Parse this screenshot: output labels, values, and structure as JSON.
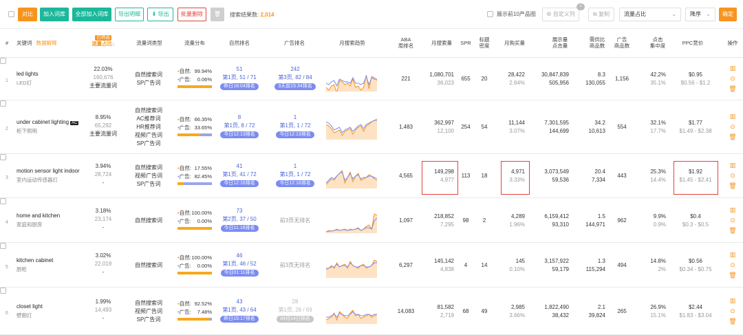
{
  "toolbar": {
    "compare": "对比",
    "add_lib": "加入词库",
    "add_all_lib": "全部加入词库",
    "export_detail": "导出明细",
    "export": "导出",
    "batch_delete": "批量删除",
    "result_label": "搜索结果数:",
    "result_count": "2,014",
    "show_top10": "展示前10产品图",
    "custom_cols": "自定义列",
    "custom_badge": "+",
    "copy": "复制",
    "sort_field": "流量占比",
    "sort_order": "降序",
    "confirm": "确定"
  },
  "header": {
    "num": "#",
    "keyword": "关键词",
    "keyword_link": "数据解释",
    "flow_share_tag": "已筛选",
    "flow_share": "流量占比",
    "flow_type": "流量词类型",
    "flow_dist": "流量分布",
    "natural_rank": "自然排名",
    "ad_rank": "广告排名",
    "trend": "月搜索趋势",
    "aba1": "ABA",
    "aba2": "周排名",
    "monthly_search": "月搜索量",
    "spr": "SPR",
    "title_density1": "标题",
    "title_density2": "密度",
    "monthly_buy": "月购买量",
    "impressions1": "展示量",
    "impressions2": "点击量",
    "supply1": "需供比",
    "supply2": "商品数",
    "ad_products1": "广告",
    "ad_products2": "商品数",
    "click_conc1": "点击",
    "click_conc2": "集中度",
    "ppc": "PPC竞价",
    "ops": "操作"
  },
  "rows": [
    {
      "num": "1",
      "keyword": "led lights",
      "ac": "",
      "cn": "LED灯",
      "share": "22.03%",
      "share_sub": "160,676",
      "share_type": "主要流量词",
      "types": [
        "自然搜索词",
        "SP广告词"
      ],
      "nat_label": "自然:",
      "nat_pct": "99.94%",
      "ad_label": "广告:",
      "ad_pct": "0.06%",
      "nat_frac": 0.9994,
      "nr_main": "51",
      "nr_page": "第1页, 51 / 71",
      "nr_badge": "昨日18:04排名",
      "ar_main": "242",
      "ar_page": "第3页, 82 / 84",
      "ar_badge": "3天前15:34排名",
      "aba": "221",
      "ms": "1,080,701",
      "ms_sub": "36,023",
      "spr": "655",
      "td": "20",
      "mb": "28,422",
      "mb_sub": "2.64%",
      "imp": "30,847,839",
      "clk": "505,956",
      "sd": "8.3",
      "sd_sub": "130,055",
      "adp": "1,156",
      "cc": "42.2%",
      "cc_sub": "35.1%",
      "ppc": "$0.95",
      "ppc_sub": "$0.56 - $1.2",
      "trend_a": [
        30,
        34,
        28,
        26,
        38,
        20,
        22,
        26,
        24,
        28,
        18,
        30,
        28,
        34,
        30,
        12,
        32,
        14,
        16,
        20
      ],
      "trend_b": [
        24,
        26,
        22,
        20,
        28,
        18,
        20,
        22,
        22,
        24,
        16,
        24,
        24,
        26,
        24,
        14,
        26,
        16,
        18,
        18
      ]
    },
    {
      "num": "2",
      "keyword": "under cabinet lighting",
      "ac": "AC",
      "cn": "柜下照明",
      "share": "8.95%",
      "share_sub": "65,292",
      "share_type": "主要流量词",
      "types": [
        "自然搜索词",
        "AC推荐词",
        "HR推荐词",
        "视频广告词",
        "SP广告词"
      ],
      "nat_label": "自然:",
      "nat_pct": "66.35%",
      "ad_label": "广告:",
      "ad_pct": "33.65%",
      "nat_frac": 0.6635,
      "nr_main": "8",
      "nr_page": "第1页, 8 / 72",
      "nr_badge": "今日12:13排名",
      "ar_main": "1",
      "ar_page": "第1页, 1 / 72",
      "ar_badge": "今日12:13排名",
      "aba": "1,483",
      "ms": "362,997",
      "ms_sub": "12,100",
      "spr": "254",
      "td": "54",
      "mb": "11,144",
      "mb_sub": "3.07%",
      "imp": "7,301,595",
      "clk": "144,699",
      "sd": "34.2",
      "sd_sub": "10,613",
      "adp": "554",
      "cc": "32.1%",
      "cc_sub": "17.7%",
      "ppc": "$1.77",
      "ppc_sub": "$1.49 - $2.38",
      "trend_a": [
        14,
        16,
        20,
        26,
        24,
        22,
        30,
        24,
        22,
        20,
        28,
        22,
        18,
        16,
        24,
        16,
        14,
        10,
        8,
        6
      ],
      "trend_b": [
        10,
        12,
        16,
        22,
        20,
        18,
        26,
        22,
        20,
        18,
        24,
        20,
        16,
        14,
        20,
        14,
        12,
        10,
        8,
        8
      ]
    },
    {
      "num": "3",
      "keyword": "motion sensor light indoor",
      "ac": "",
      "cn": "室内运动传感器灯",
      "share": "3.94%",
      "share_sub": "28,724",
      "share_type": "-",
      "types": [
        "自然搜索词",
        "视频广告词",
        "SP广告词"
      ],
      "nat_label": "自然:",
      "nat_pct": "17.55%",
      "ad_label": "广告:",
      "ad_pct": "82.45%",
      "nat_frac": 0.1755,
      "nr_main": "41",
      "nr_page": "第1页, 41 / 72",
      "nr_badge": "今日12:16排名",
      "ar_main": "1",
      "ar_page": "第1页, 1 / 72",
      "ar_badge": "今日12:16排名",
      "aba": "4,565",
      "ms": "149,298",
      "ms_sub": "4,977",
      "spr": "113",
      "td": "18",
      "mb": "4,971",
      "mb_sub": "3.33%",
      "imp": "3,073,549",
      "clk": "59,536",
      "sd": "20.4",
      "sd_sub": "7,334",
      "adp": "443",
      "cc": "25.3%",
      "cc_sub": "14.4%",
      "ppc": "$1.92",
      "ppc_sub": "$1.45 - $2.41",
      "trend_a": [
        30,
        26,
        22,
        24,
        18,
        14,
        10,
        28,
        20,
        12,
        26,
        18,
        14,
        24,
        22,
        20,
        16,
        18,
        22,
        24
      ],
      "trend_b": [
        28,
        24,
        20,
        22,
        18,
        14,
        12,
        24,
        20,
        14,
        22,
        18,
        16,
        22,
        20,
        20,
        18,
        18,
        20,
        22
      ]
    },
    {
      "num": "4",
      "keyword": "home and kitchen",
      "ac": "",
      "cn": "家庭和厨房",
      "share": "3.18%",
      "share_sub": "23,174",
      "share_type": "-",
      "types": [
        "自然搜索词"
      ],
      "nat_label": "自然:",
      "nat_pct": "100.00%",
      "ad_label": "广告:",
      "ad_pct": "0.00%",
      "nat_frac": 1.0,
      "nr_main": "73",
      "nr_page": "第2页, 37 / 50",
      "nr_badge": "今日11:16排名",
      "ar_main": "",
      "ar_page": "前3页无排名",
      "ar_badge": "",
      "aba": "1,097",
      "ms": "218,852",
      "ms_sub": "7,295",
      "spr": "98",
      "td": "2",
      "mb": "4,289",
      "mb_sub": "1.96%",
      "imp": "6,159,412",
      "clk": "93,310",
      "sd": "1.5",
      "sd_sub": "144,971",
      "adp": "962",
      "cc": "9.9%",
      "cc_sub": "0.9%",
      "ppc": "$0.4",
      "ppc_sub": "$0.3 - $0.5",
      "trend_a": [
        34,
        32,
        33,
        32,
        30,
        32,
        31,
        30,
        32,
        30,
        31,
        30,
        28,
        32,
        30,
        26,
        24,
        30,
        8,
        10
      ],
      "trend_b": [
        34,
        33,
        33,
        32,
        31,
        32,
        31,
        31,
        32,
        31,
        31,
        30,
        29,
        32,
        30,
        28,
        28,
        30,
        18,
        14
      ]
    },
    {
      "num": "5",
      "keyword": "kitchen cabinet",
      "ac": "",
      "cn": "厨柜",
      "share": "3.02%",
      "share_sub": "22,019",
      "share_type": "-",
      "types": [
        "自然搜索词"
      ],
      "nat_label": "自然:",
      "nat_pct": "100.00%",
      "ad_label": "广告:",
      "ad_pct": "0.00%",
      "nat_frac": 1.0,
      "nr_main": "46",
      "nr_page": "第1页, 46 / 52",
      "nr_badge": "今日01:11排名",
      "ar_main": "",
      "ar_page": "前3页无排名",
      "ar_badge": "",
      "aba": "6,297",
      "ms": "145,142",
      "ms_sub": "4,838",
      "spr": "4",
      "td": "14",
      "mb": "145",
      "mb_sub": "0.10%",
      "imp": "3,157,922",
      "clk": "59,179",
      "sd": "1.3",
      "sd_sub": "115,294",
      "adp": "494",
      "cc": "14.8%",
      "cc_sub": "2%",
      "ppc": "$0.56",
      "ppc_sub": "$0.34 - $0.75",
      "trend_a": [
        24,
        22,
        18,
        22,
        14,
        20,
        18,
        16,
        22,
        12,
        18,
        20,
        22,
        18,
        16,
        22,
        20,
        18,
        10,
        12
      ],
      "trend_b": [
        22,
        22,
        20,
        20,
        16,
        20,
        18,
        18,
        20,
        14,
        18,
        20,
        20,
        18,
        18,
        20,
        20,
        18,
        14,
        14
      ]
    },
    {
      "num": "6",
      "keyword": "closet light",
      "ac": "",
      "cn": "壁橱灯",
      "share": "1.99%",
      "share_sub": "14,493",
      "share_type": "-",
      "types": [
        "自然搜索词",
        "视频广告词",
        "SP广告词"
      ],
      "nat_label": "自然:",
      "nat_pct": "92.52%",
      "ad_label": "广告:",
      "ad_pct": "7.48%",
      "nat_frac": 0.9252,
      "nr_main": "43",
      "nr_page": "第1页, 43 / 64",
      "nr_badge": "昨日15:17排名",
      "ar_main": "28",
      "ar_page": "第1页, 28 / 69",
      "ar_badge": "04月14日排名",
      "aba": "14,083",
      "ms": "81,582",
      "ms_sub": "2,719",
      "spr": "68",
      "td": "49",
      "mb": "2,985",
      "mb_sub": "3.66%",
      "imp": "1,822,490",
      "clk": "38,432",
      "sd": "2.1",
      "sd_sub": "39,824",
      "adp": "265",
      "cc": "26.9%",
      "cc_sub": "15.1%",
      "ppc": "$2.44",
      "ppc_sub": "$1.83 - $3.04",
      "trend_a": [
        30,
        28,
        26,
        20,
        30,
        18,
        22,
        26,
        28,
        20,
        16,
        24,
        22,
        28,
        26,
        24,
        22,
        26,
        24,
        22
      ],
      "trend_b": [
        26,
        26,
        24,
        22,
        26,
        20,
        22,
        24,
        24,
        22,
        18,
        22,
        22,
        24,
        24,
        22,
        22,
        24,
        22,
        22
      ]
    }
  ],
  "colors": {
    "orange": "#f7941e",
    "green": "#1bb89a",
    "red": "#e0433a",
    "blue": "#4a63d8",
    "trend_a": "#f7941e",
    "trend_b": "#7b8cf0"
  },
  "icons": [
    "bar-chart-icon",
    "more-icon",
    "delete-icon",
    "copy-icon",
    "settings-icon",
    "trash-icon"
  ]
}
